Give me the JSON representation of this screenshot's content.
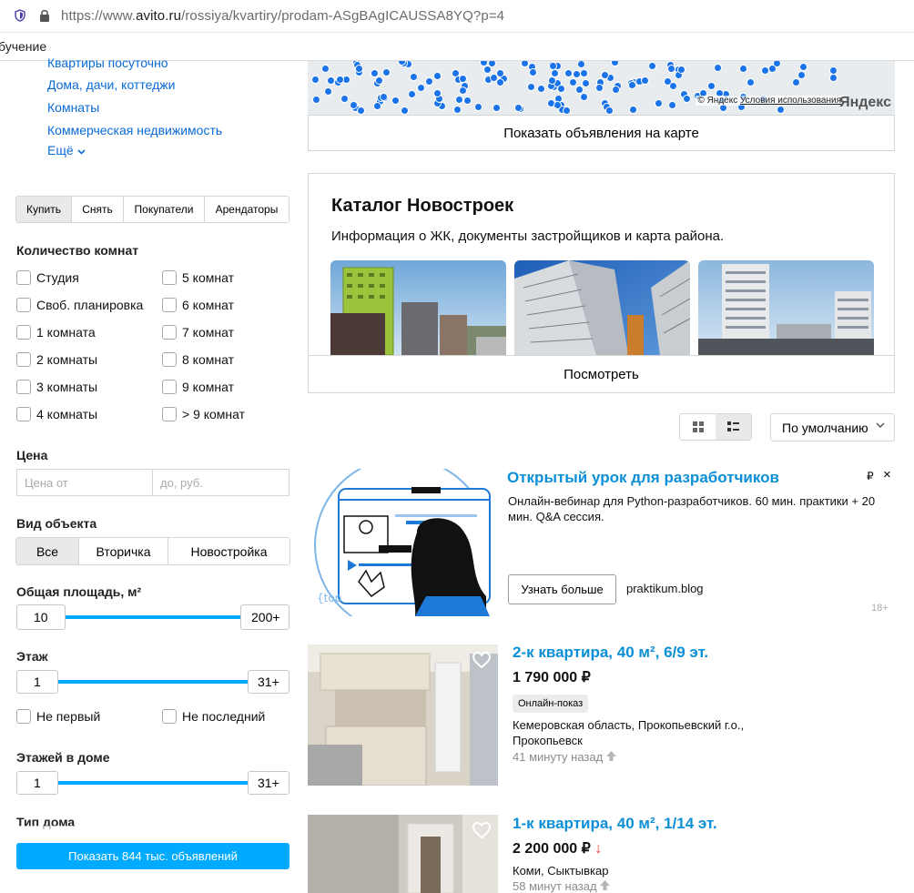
{
  "browser": {
    "url_prefix": "https://www.",
    "url_domain": "avito.ru",
    "url_path": "/rossiya/kvartiry/prodam-ASgBAgICAUSSA8YQ?p=4",
    "bookmark_label": "бучение"
  },
  "sidebar": {
    "categories": [
      "Квартиры посуточно",
      "Дома, дачи, коттеджи",
      "Комнаты",
      "Коммерческая недвижимость",
      "Ещё"
    ],
    "deal_tabs": [
      "Купить",
      "Снять",
      "Покупатели",
      "Арендаторы"
    ],
    "deal_active": "Купить",
    "rooms_title": "Количество комнат",
    "rooms_left": [
      "Студия",
      "Своб. планировка",
      "1 комната",
      "2 комнаты",
      "3 комнаты",
      "4 комнаты"
    ],
    "rooms_right": [
      "5 комнат",
      "6 комнат",
      "7 комнат",
      "8 комнат",
      "9 комнат",
      "> 9 комнат"
    ],
    "price_title": "Цена",
    "price_from_placeholder": "Цена от",
    "price_to_placeholder": "до, руб.",
    "object_title": "Вид объекта",
    "object_tabs": [
      "Все",
      "Вторичка",
      "Новостройка"
    ],
    "area_title": "Общая площадь, м²",
    "area_min": "10",
    "area_max": "200+",
    "floor_title": "Этаж",
    "floor_min": "1",
    "floor_max": "31+",
    "not_first": "Не первый",
    "not_last": "Не последний",
    "floors_title": "Этажей в доме",
    "floors_min": "1",
    "floors_max": "31+",
    "house_type_title": "Тип дома",
    "show_button": "Показать 844 тыс. объявлений"
  },
  "map": {
    "attribution": "© Яндекс",
    "terms": "Условия использования",
    "logo": "Яндекс",
    "show_on_map": "Показать объявления на карте"
  },
  "catalog": {
    "title": "Каталог Новостроек",
    "subtitle": "Информация о ЖК, документы застройщиков и карта района.",
    "button": "Посмотреть"
  },
  "sort": {
    "label": "По умолчанию"
  },
  "ad": {
    "title": "Открытый урок для разработчиков",
    "description": "Онлайн-вебинар для Python-разработчиков. 60 мин. практики + 20 мин. Q&A сессия.",
    "button": "Узнать больше",
    "domain": "praktikum.blog",
    "age": "18+",
    "ruble": "₽",
    "close": "×"
  },
  "listings": [
    {
      "title": "2-к квартира, 40 м², 6/9 эт.",
      "price": "1 790 000 ₽",
      "badge": "Онлайн-показ",
      "location": "Кемеровская область, Прокопьевский г.о., Прокопьевск",
      "time": "41 минуту назад"
    },
    {
      "title": "1-к квартира, 40 м², 1/14 эт.",
      "price": "2 200 000 ₽",
      "price_change": "↓",
      "location": "Коми, Сыктывкар",
      "time": "58 минут назад"
    }
  ],
  "colors": {
    "accent": "#00aaff",
    "link": "#0b6ad6",
    "title": "#0b8fd6"
  }
}
